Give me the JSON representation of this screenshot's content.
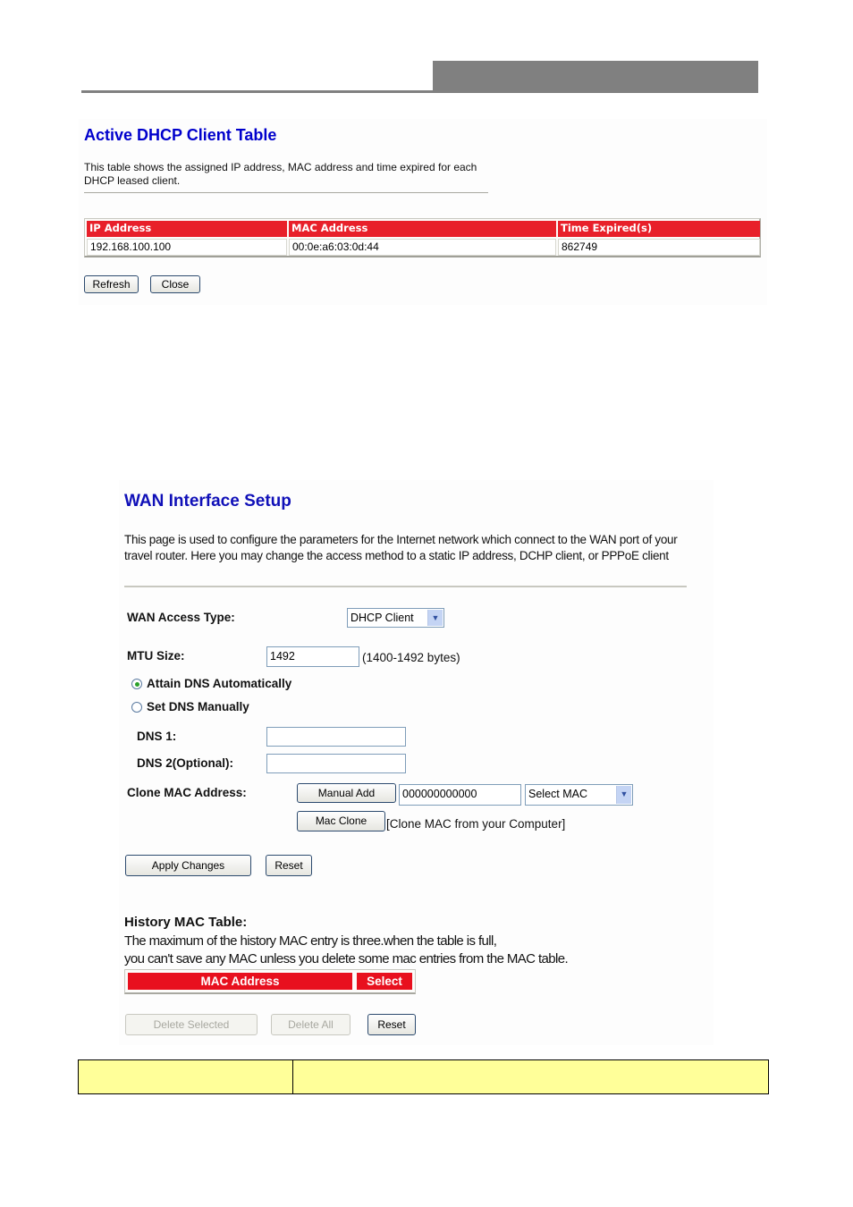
{
  "dhcp_panel": {
    "title": "Active DHCP Client Table",
    "description": "This table shows the assigned IP address, MAC address and time expired for each DHCP leased client.",
    "table": {
      "headers": [
        "IP Address",
        "MAC Address",
        "Time Expired(s)"
      ],
      "rows": [
        [
          "192.168.100.100",
          "00:0e:a6:03:0d:44",
          "862749"
        ]
      ]
    },
    "buttons": {
      "refresh": "Refresh",
      "close": "Close"
    },
    "colors": {
      "title": "#0000cc",
      "header_bg": "#e8202a"
    }
  },
  "wan_panel": {
    "title": "WAN Interface Setup",
    "description": "This page is used to configure the parameters for the Internet network which connect to the WAN port of your travel router. Here you may change the access method to a static IP address, DCHP client, or PPPoE client",
    "wan_access_type": {
      "label": "WAN Access Type:",
      "selected": "DHCP Client"
    },
    "mtu": {
      "label": "MTU Size:",
      "value": "1492",
      "hint": "(1400-1492 bytes)"
    },
    "dns_mode": {
      "options": [
        {
          "label": "Attain DNS Automatically",
          "checked": true
        },
        {
          "label": "Set DNS Manually",
          "checked": false
        }
      ]
    },
    "dns1": {
      "label": "DNS 1:",
      "value": ""
    },
    "dns2": {
      "label": "DNS 2(Optional):",
      "value": ""
    },
    "clone_mac": {
      "label": "Clone MAC Address:",
      "manual_add_label": "Manual Add",
      "mac_value": "000000000000",
      "select_mac": "Select MAC",
      "mac_clone_label": "Mac Clone",
      "mac_clone_hint": "[Clone MAC from your Computer]"
    },
    "buttons": {
      "apply": "Apply Changes",
      "reset": "Reset"
    },
    "history": {
      "title": "History MAC Table:",
      "line1": "The maximum of the history MAC entry is three.when the table is full,",
      "line2": "you can't save any MAC unless you delete some mac entries from the MAC table.",
      "headers": [
        "MAC Address",
        "Select"
      ],
      "buttons": {
        "delete_selected": "Delete Selected",
        "delete_all": "Delete All",
        "reset": "Reset"
      }
    },
    "colors": {
      "title": "#1010b8",
      "header_bg": "#e8101e"
    }
  },
  "bottom_table": {
    "cells": [
      "",
      ""
    ],
    "color": "#ffff99"
  }
}
